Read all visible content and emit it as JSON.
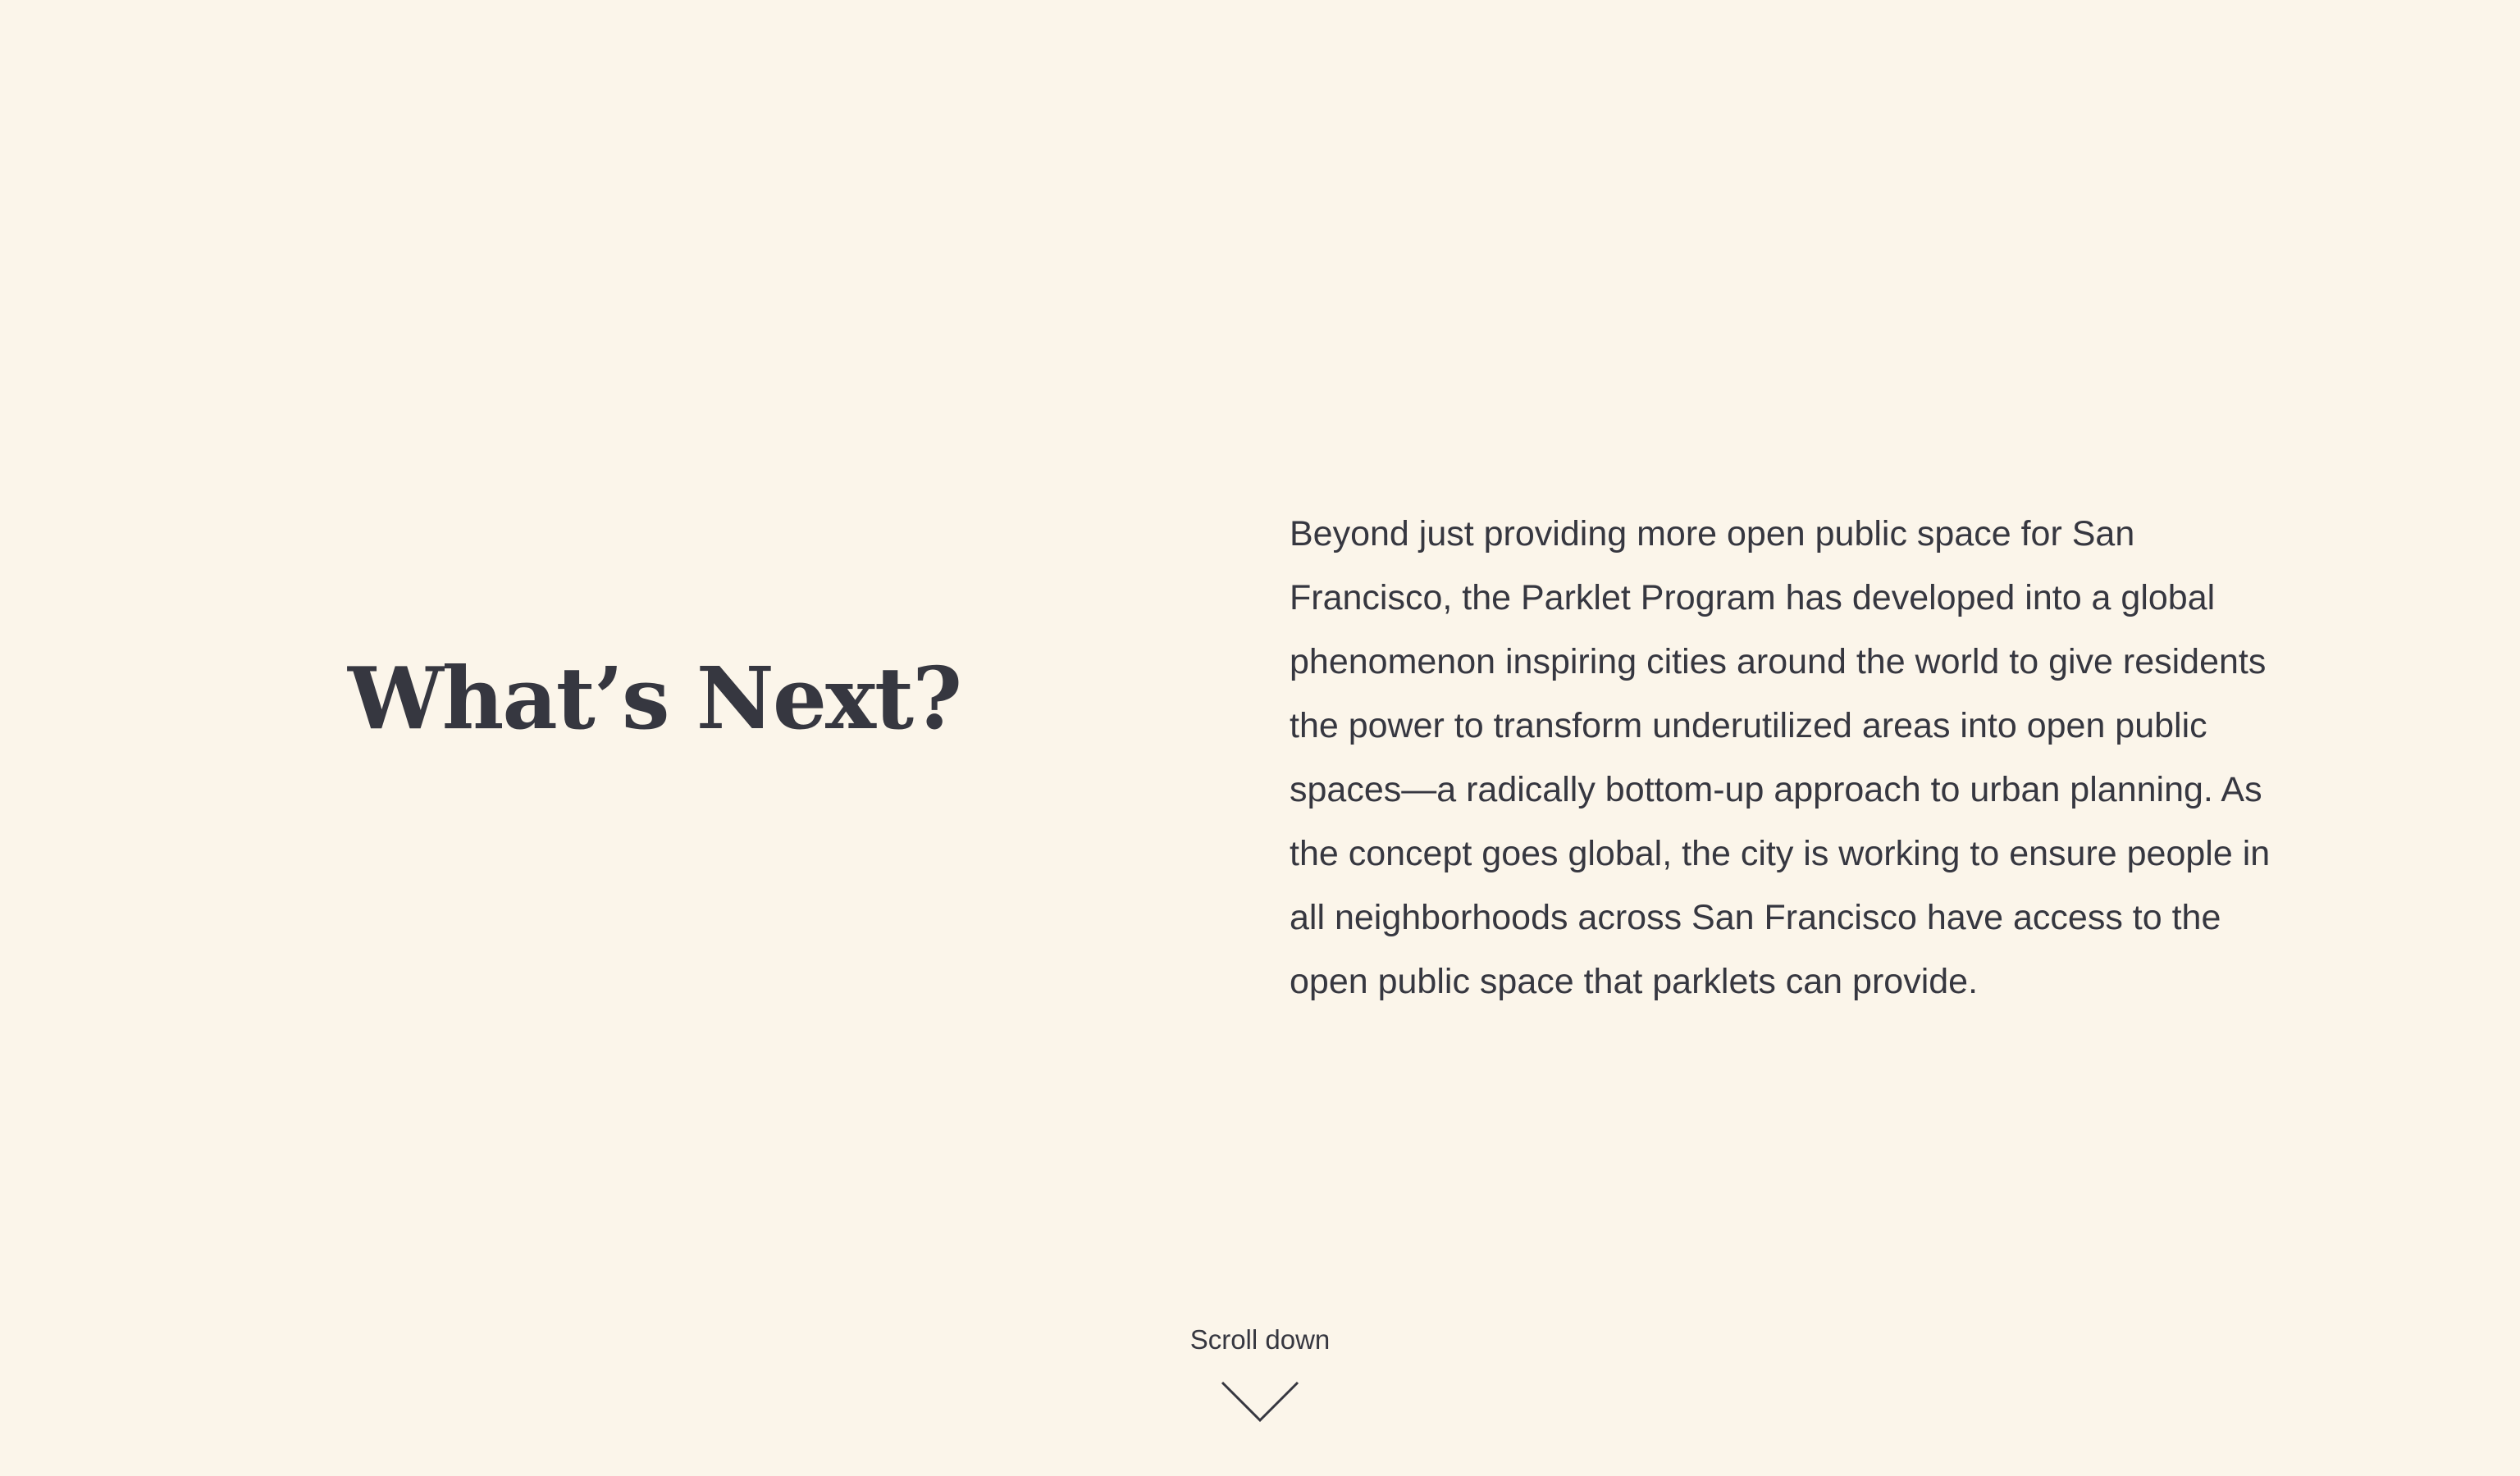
{
  "section": {
    "heading": "What’s Next?",
    "body": "Beyond just providing more open public space for San Francisco, the Parklet Program has developed into a global phenomenon inspiring cities around the world to give residents the power to transform underutilized areas into open public spaces—a radically bottom-up approach to urban planning. As the concept goes global, the city is working to ensure people in all neighborhoods across San Francisco have access to the open public space that parklets can provide."
  },
  "scroll": {
    "label": "Scroll down",
    "icon": "chevron-down-icon"
  },
  "colors": {
    "background": "#fbf5ea",
    "text": "#363740"
  }
}
